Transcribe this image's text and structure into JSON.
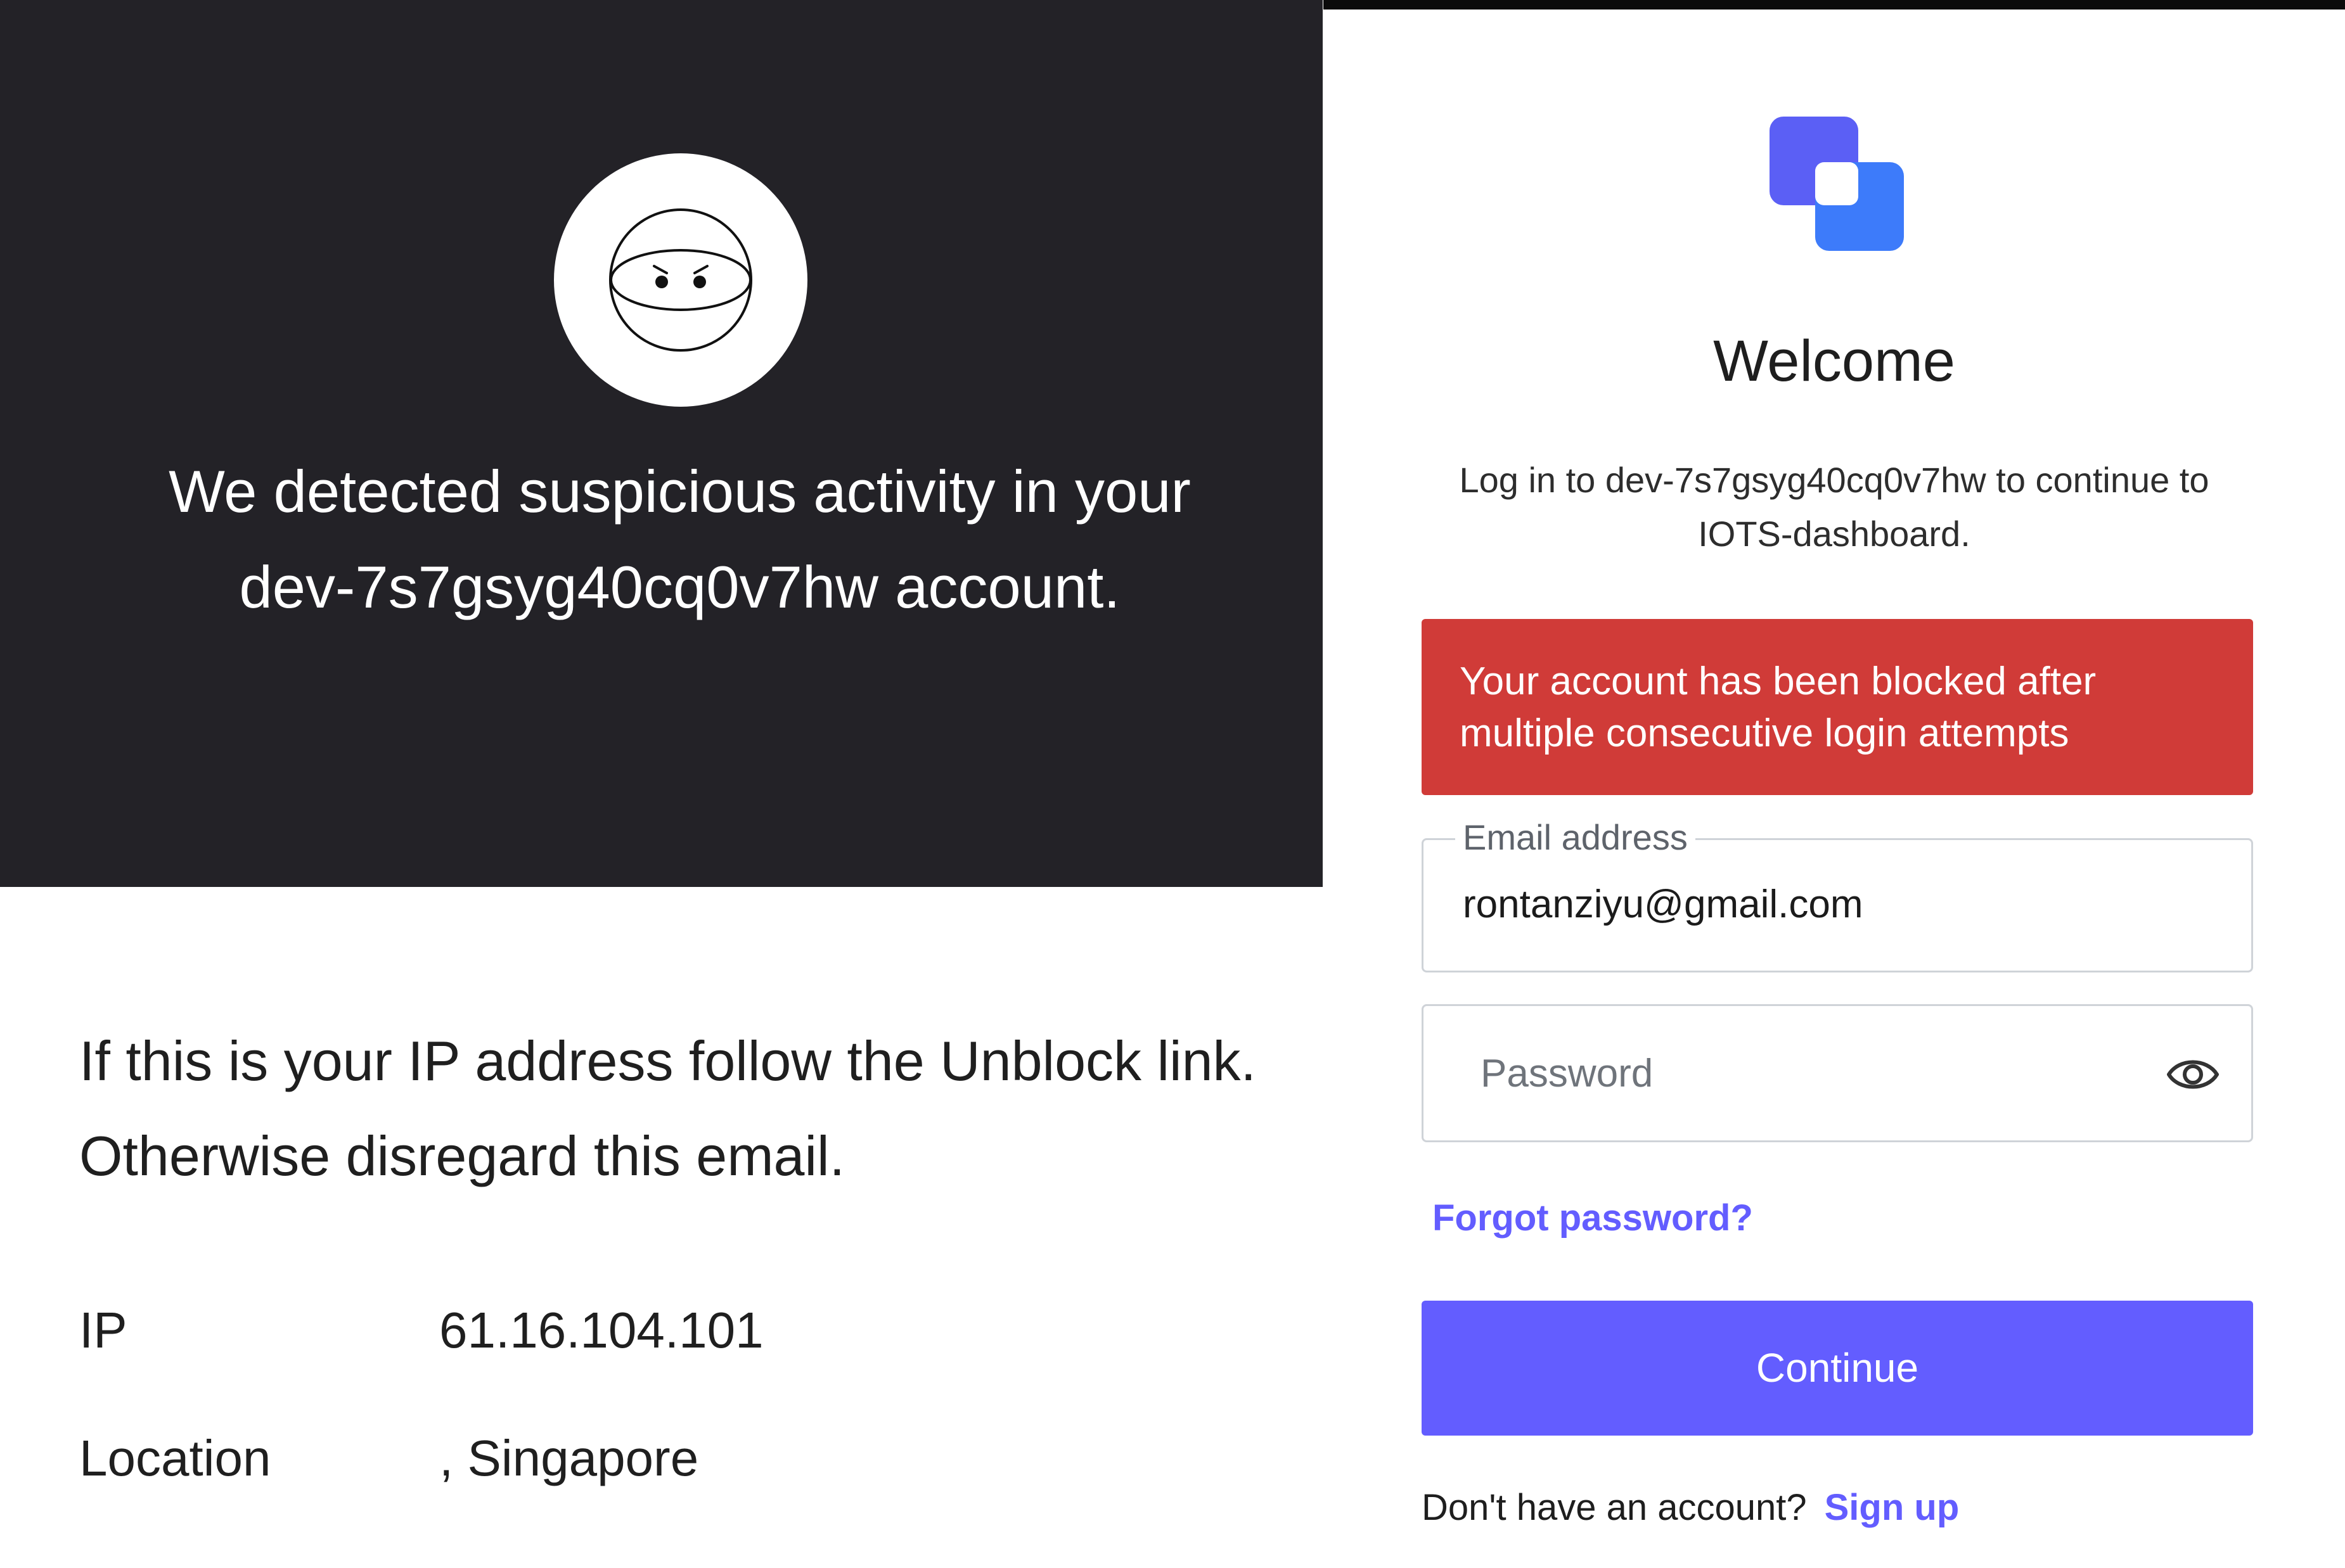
{
  "email": {
    "headline": "We detected suspicious activity in your dev-7s7gsyg40cq0v7hw account.",
    "body_line1": "If this is your IP address follow the Unblock link.",
    "body_line2": "Otherwise disregard this email.",
    "details": [
      {
        "key": "IP",
        "value": "61.16.104.101"
      },
      {
        "key": "Location",
        "value": ", Singapore"
      }
    ],
    "colors": {
      "header_bg": "#232227",
      "text": "#1f1f1f"
    },
    "icon": "masked-robot-icon"
  },
  "login": {
    "logo_icon": "app-logo-icon",
    "title": "Welcome",
    "subtitle": "Log in to dev-7s7gsyg40cq0v7hw to continue to IOTS-dashboard.",
    "error_message": "Your account has been blocked after multiple consecutive login attempts",
    "email_field": {
      "label": "Email address",
      "value": "rontanziyu@gmail.com"
    },
    "password_field": {
      "placeholder": "Password",
      "toggle_icon": "eye-icon"
    },
    "forgot_password": "Forgot password?",
    "continue_label": "Continue",
    "signup_prompt": "Don't have an account?",
    "signup_link": "Sign up",
    "colors": {
      "accent": "#635dff",
      "error": "#d03b38",
      "logo_primary": "#5b5ff5",
      "logo_secondary": "#3d7bfa"
    }
  }
}
